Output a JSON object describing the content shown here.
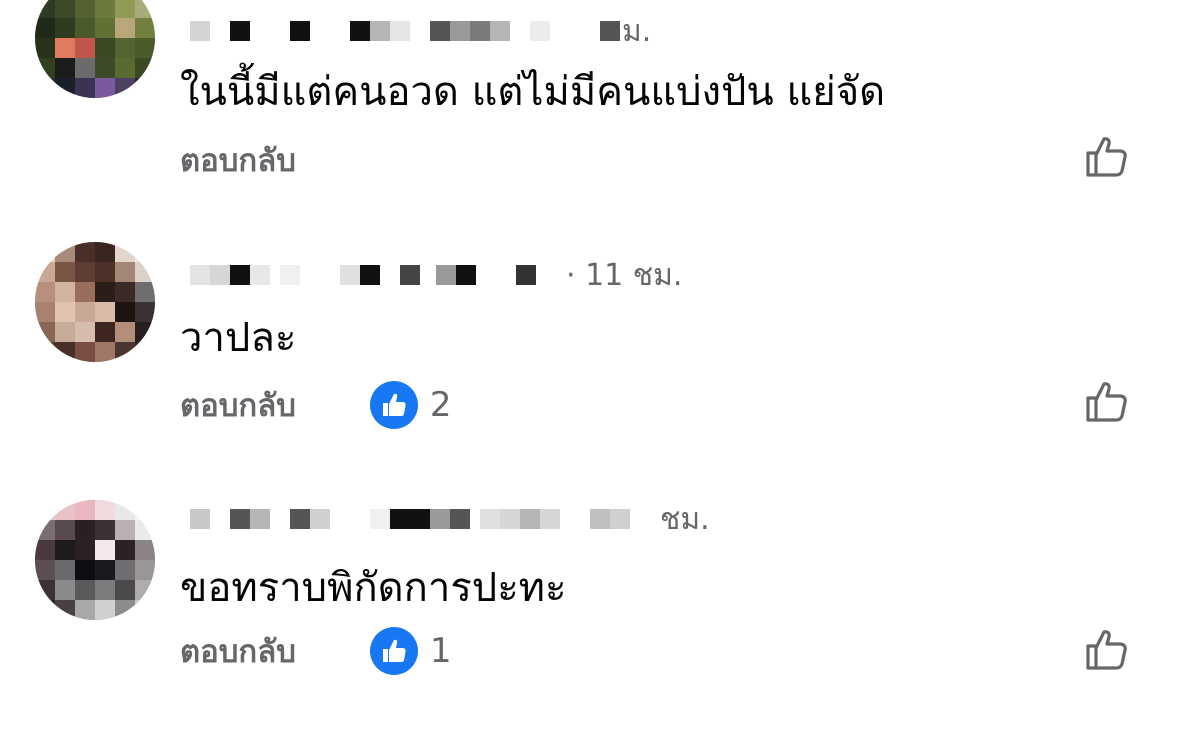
{
  "comments": [
    {
      "time": "ม.",
      "text": "ในนี้มีแต่คนอวด แต่ไม่มีคนแบ่งปัน แย่จัด",
      "reply_label": "ตอบกลับ",
      "like_count": null
    },
    {
      "time": "· 11 ชม.",
      "text": "วาปละ",
      "reply_label": "ตอบกลับ",
      "like_count": "2"
    },
    {
      "time": "ชม.",
      "text": "ขอทราบพิกัดการปะทะ",
      "reply_label": "ตอบกลับ",
      "like_count": "1"
    }
  ],
  "icons": {
    "reaction_badge": "like-icon",
    "like_button": "thumbs-up-outline-icon"
  },
  "colors": {
    "accent": "#1877f2",
    "secondary_text": "#65676b",
    "primary_text": "#050505"
  }
}
